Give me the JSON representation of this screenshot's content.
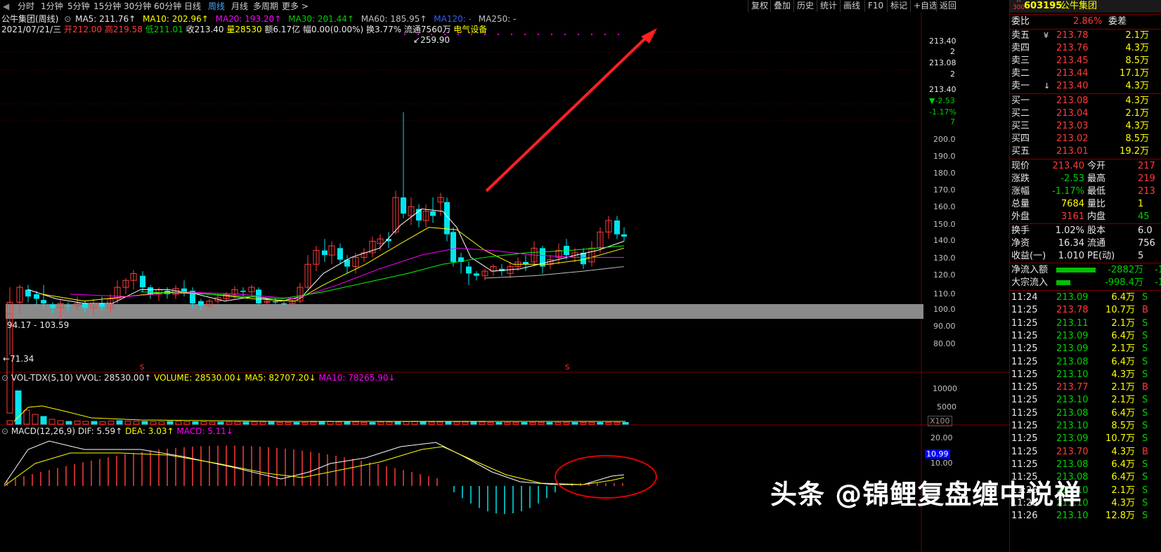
{
  "topbar": {
    "periods": [
      "分时",
      "1分钟",
      "5分钟",
      "15分钟",
      "30分钟",
      "60分钟",
      "日线",
      "周线",
      "月线",
      "多周期",
      "更多 >"
    ],
    "active_period": "周线",
    "tools": [
      "复权",
      "叠加",
      "历史",
      "统计",
      "画线",
      "F10",
      "标记",
      "+自选",
      "返回"
    ]
  },
  "ma_line": {
    "name": "公牛集团(周线)",
    "ma5": "MA5: 211.76↑",
    "ma10": "MA10: 202.96↑",
    "ma20": "MA20: 193.20↑",
    "ma30": "MA30: 201.44↑",
    "ma60": "MA60: 185.95↑",
    "ma120": "MA120: -",
    "ma250": "MA250: -"
  },
  "info_line": {
    "date": "2021/07/21/三",
    "open_label": "开",
    "open": "212.00",
    "high_label": "高",
    "high": "219.58",
    "low_label": "低",
    "low": "211.01",
    "close": "收213.40",
    "vol_label": "量",
    "vol": "28530",
    "rest": "额6.17亿 幅0.00(0.00%) 换3.77% 流通7560万",
    "sector": "电气设备"
  },
  "price_axis": [
    "213.40",
    "2",
    "213.08",
    "2",
    "213.40",
    "▼-2.53",
    "-1.17%",
    "7",
    "200.0",
    "190.0",
    "180.0",
    "170.0",
    "160.0",
    "150.0",
    "140.0",
    "130.0",
    "120.0",
    "110.0",
    "100.0",
    "90.00",
    "80.00"
  ],
  "annotations": {
    "high": "259.90",
    "low": "71.34",
    "range": "94.17 - 103.59",
    "s1": "S",
    "s2": "S"
  },
  "vol_panel": {
    "title": "VOL-TDX(5,10)",
    "vvol": "VVOL: 28530.00↑",
    "volume": "VOLUME: 28530.00↓",
    "ma5": "MA5: 82707.20↓",
    "ma10": "MA10: 78265.90↓",
    "axis": [
      "10000",
      "5000",
      "X100"
    ]
  },
  "macd_panel": {
    "title": "MACD(12,26,9)",
    "dif": "DIF: 5.59↑",
    "dea": "DEA: 3.03↑",
    "macd": "MACD: 5.11↓",
    "axis": [
      "20.00",
      "10.99",
      "10.00"
    ]
  },
  "right": {
    "code_badge_top": "R",
    "code_badge_bottom": "300",
    "code": "603195",
    "name": "公牛集团",
    "weibi_label": "委比",
    "weibi": "2.86%",
    "weicha_label": "委差",
    "asks": [
      {
        "label": "卖五",
        "mark": "¥",
        "price": "213.78",
        "vol": "2.1万"
      },
      {
        "label": "卖四",
        "mark": "",
        "price": "213.76",
        "vol": "4.3万"
      },
      {
        "label": "卖三",
        "mark": "",
        "price": "213.45",
        "vol": "8.5万"
      },
      {
        "label": "卖二",
        "mark": "",
        "price": "213.44",
        "vol": "17.1万"
      },
      {
        "label": "卖一",
        "mark": "↓",
        "price": "213.40",
        "vol": "4.3万"
      }
    ],
    "bids": [
      {
        "label": "买一",
        "price": "213.08",
        "vol": "4.3万"
      },
      {
        "label": "买二",
        "price": "213.04",
        "vol": "2.1万"
      },
      {
        "label": "买三",
        "price": "213.03",
        "vol": "4.3万"
      },
      {
        "label": "买四",
        "price": "213.02",
        "vol": "8.5万"
      },
      {
        "label": "买五",
        "price": "213.01",
        "vol": "19.2万"
      }
    ],
    "quote": [
      {
        "l1": "现价",
        "v1": "213.40",
        "l2": "今开",
        "v2": "217"
      },
      {
        "l1": "涨跌",
        "v1": "-2.53",
        "l2": "最高",
        "v2": "219"
      },
      {
        "l1": "涨幅",
        "v1": "-1.17%",
        "l2": "最低",
        "v2": "213"
      },
      {
        "l1": "总量",
        "v1": "7684",
        "l2": "量比",
        "v2": "1"
      },
      {
        "l1": "外盘",
        "v1": "3161",
        "l2": "内盘",
        "v2": "45"
      }
    ],
    "fund": [
      {
        "l1": "换手",
        "v1": "1.02%",
        "l2": "股本",
        "v2": "6.0"
      },
      {
        "l1": "净资",
        "v1": "16.34",
        "l2": "流通",
        "v2": "756"
      },
      {
        "l1": "收益(一)",
        "v1": "1.010",
        "l2": "PE(动)",
        "v2": "5"
      }
    ],
    "flow": [
      {
        "label": "净流入额",
        "value": "-2882万",
        "tail": "-1"
      },
      {
        "label": "大宗流入",
        "value": "-998.4万",
        "tail": "-1"
      }
    ],
    "ticks": [
      {
        "t": "11:24",
        "p": "213.09",
        "v": "6.4万",
        "s": "S"
      },
      {
        "t": "11:25",
        "p": "213.78",
        "v": "10.7万",
        "s": "B"
      },
      {
        "t": "11:25",
        "p": "213.11",
        "v": "2.1万",
        "s": "S"
      },
      {
        "t": "11:25",
        "p": "213.09",
        "v": "6.4万",
        "s": "S"
      },
      {
        "t": "11:25",
        "p": "213.09",
        "v": "2.1万",
        "s": "S"
      },
      {
        "t": "11:25",
        "p": "213.08",
        "v": "6.4万",
        "s": "S"
      },
      {
        "t": "11:25",
        "p": "213.10",
        "v": "4.3万",
        "s": "S"
      },
      {
        "t": "11:25",
        "p": "213.77",
        "v": "2.1万",
        "s": "B"
      },
      {
        "t": "11:25",
        "p": "213.10",
        "v": "2.1万",
        "s": "S"
      },
      {
        "t": "11:25",
        "p": "213.08",
        "v": "6.4万",
        "s": "S"
      },
      {
        "t": "11:25",
        "p": "213.10",
        "v": "8.5万",
        "s": "S"
      },
      {
        "t": "11:25",
        "p": "213.09",
        "v": "10.7万",
        "s": "S"
      },
      {
        "t": "11:25",
        "p": "213.70",
        "v": "4.3万",
        "s": "B"
      },
      {
        "t": "11:25",
        "p": "213.08",
        "v": "6.4万",
        "s": "S"
      },
      {
        "t": "11:25",
        "p": "213.08",
        "v": "6.4万",
        "s": "S"
      },
      {
        "t": "11:26",
        "p": "213.10",
        "v": "2.1万",
        "s": "S"
      },
      {
        "t": "11:26",
        "p": "213.10",
        "v": "4.3万",
        "s": "S"
      },
      {
        "t": "11:26",
        "p": "213.10",
        "v": "12.8万",
        "s": "S"
      }
    ]
  },
  "watermark": "头条 @锦鲤复盘缠中说禅",
  "colors": {
    "up": "#ff3b3b",
    "down": "#00e5ee",
    "ma5": "#ffffff",
    "ma10": "#ffff00",
    "ma20": "#ff00ff",
    "ma30": "#00ff00",
    "ma60": "#c0c0c0"
  }
}
